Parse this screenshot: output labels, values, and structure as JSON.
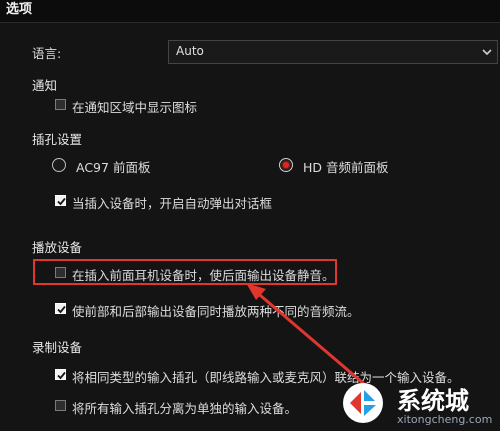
{
  "window": {
    "title": "选项"
  },
  "language": {
    "label": "语言:",
    "value": "Auto"
  },
  "notify": {
    "heading": "通知",
    "show_tray_icon": {
      "label": "在通知区域中显示图标",
      "checked": false
    }
  },
  "jack": {
    "heading": "插孔设置",
    "radio_ac97": {
      "label": "AC97 前面板",
      "selected": false
    },
    "radio_hd": {
      "label": "HD 音频前面板",
      "selected": true
    },
    "auto_popup": {
      "label": "当插入设备时，开启自动弹出对话框",
      "checked": true
    }
  },
  "playback": {
    "heading": "播放设备",
    "mute_rear": {
      "label": "在插入前面耳机设备时，使后面输出设备静音。",
      "checked": false
    },
    "dual_stream": {
      "label": "使前部和后部输出设备同时播放两种不同的音频流。",
      "checked": true
    }
  },
  "recording": {
    "heading": "录制设备",
    "tie_inputs": {
      "label": "将相同类型的输入插孔（即线路输入或麦克风）联结为一个输入设备。",
      "checked": true
    },
    "separate_inputs": {
      "label": "将所有输入插孔分离为单独的输入设备。",
      "checked": false
    }
  },
  "watermark": {
    "brand": "系统城",
    "url": "xitongcheng.com"
  },
  "colors": {
    "highlight": "#e1362e",
    "radio_dot": "#e8211d",
    "background": "#141414"
  }
}
